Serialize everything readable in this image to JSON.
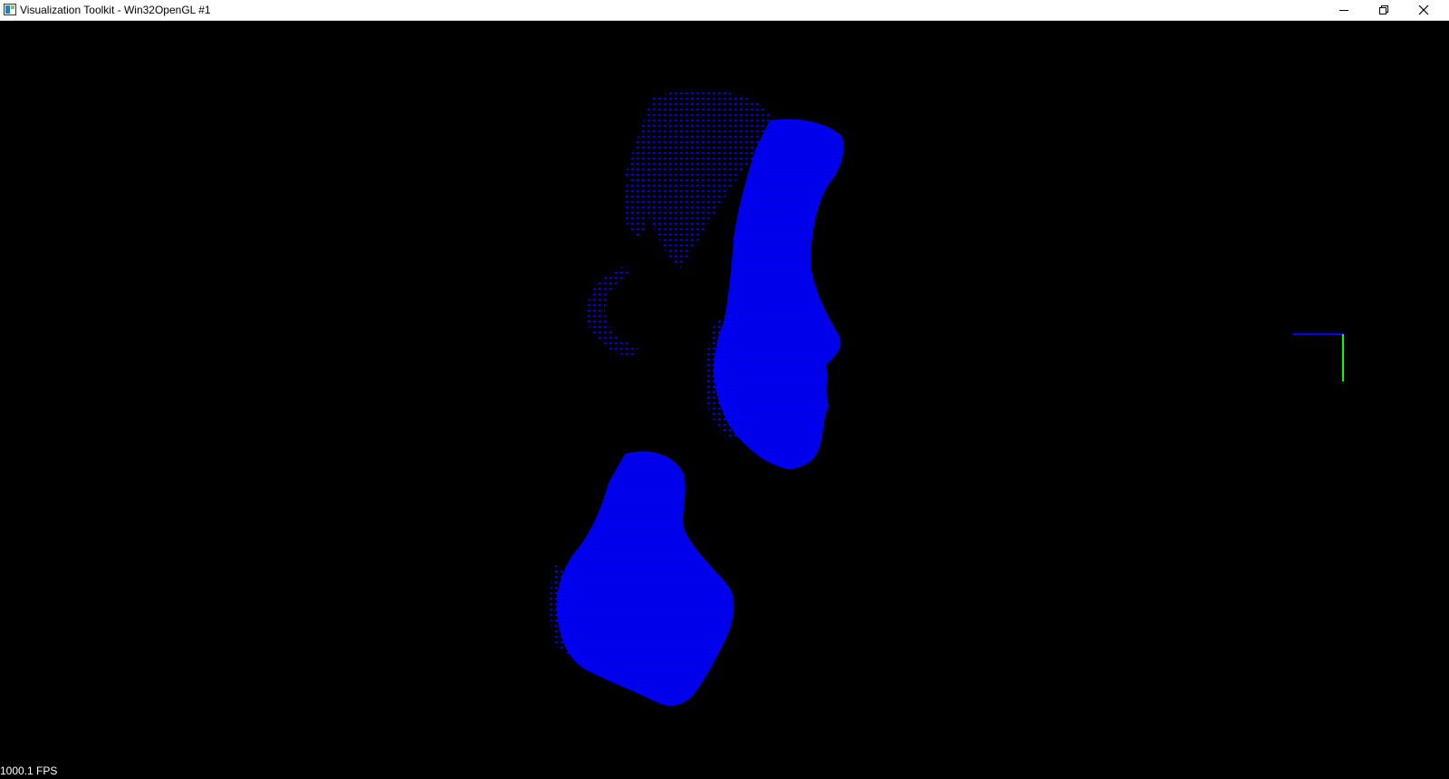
{
  "window": {
    "title": "Visualization Toolkit - Win32OpenGL #1",
    "icon": "window-app-icon",
    "buttons": [
      {
        "name": "minimize-icon"
      },
      {
        "name": "restore-icon"
      },
      {
        "name": "close-icon"
      }
    ]
  },
  "viewport": {
    "background": "#000000",
    "point_color": "#0000ff",
    "axes_colors": {
      "x": "#0000ff",
      "y": "#00ff00"
    }
  },
  "status": {
    "fps": "1000.1 FPS"
  }
}
